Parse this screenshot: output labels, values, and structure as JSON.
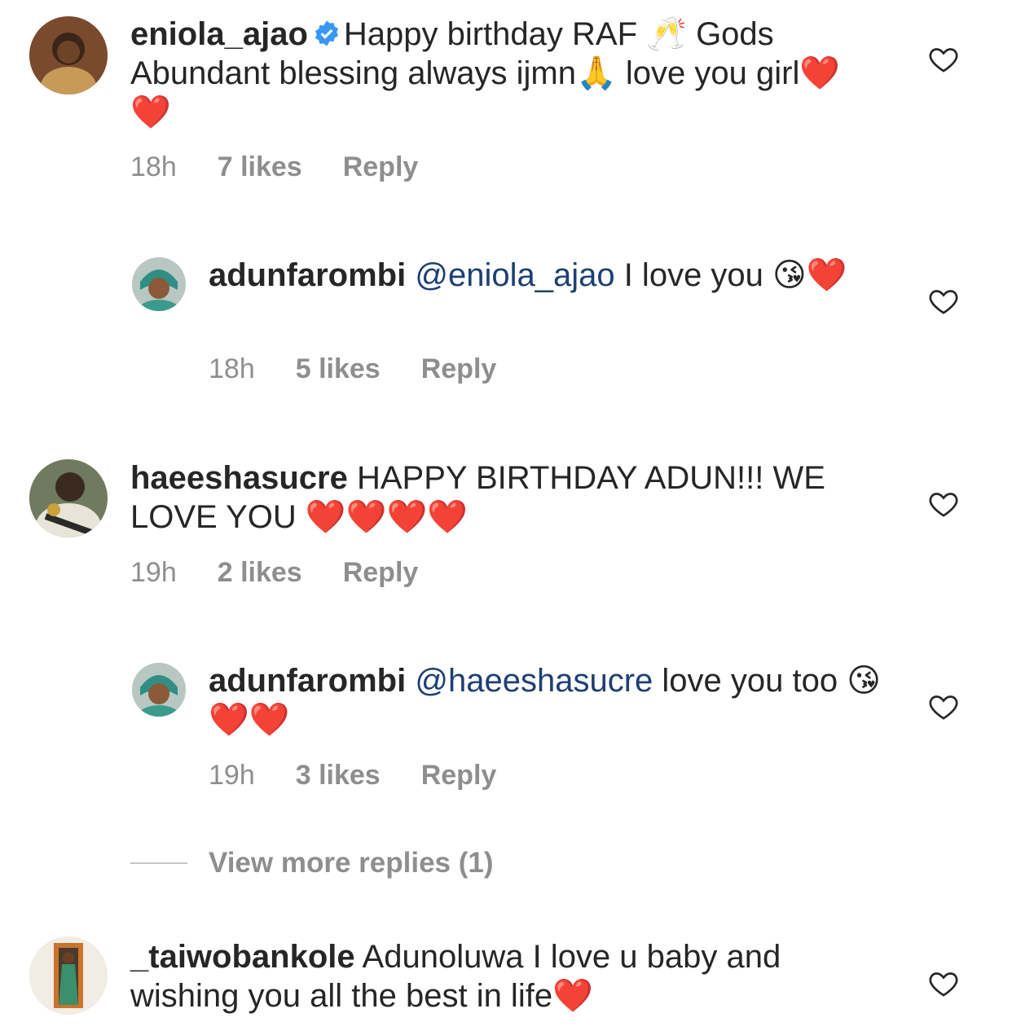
{
  "comments": [
    {
      "username": "eniola_ajao",
      "verified": true,
      "text": "Happy birthday RAF 🥂 Gods Abundant blessing always ijmn🙏 love you girl❤️❤️",
      "time": "18h",
      "likes": "7 likes",
      "reply_label": "Reply"
    },
    {
      "username": "adunfarombi",
      "mention": "@eniola_ajao",
      "text": " I love you 😘❤️",
      "time": "18h",
      "likes": "5 likes",
      "reply_label": "Reply"
    },
    {
      "username": "haeeshasucre",
      "text": "HAPPY BIRTHDAY ADUN!!! WE LOVE YOU ❤️❤️❤️❤️",
      "time": "19h",
      "likes": "2 likes",
      "reply_label": "Reply"
    },
    {
      "username": "adunfarombi",
      "mention": "@haeeshasucre",
      "text": " love you too 😘❤️❤️",
      "time": "19h",
      "likes": "3 likes",
      "reply_label": "Reply"
    },
    {
      "username": "_taiwobankole",
      "text": "Adunoluwa I love u baby and wishing you all the best in life❤️"
    }
  ],
  "view_more_replies": "View more replies (1)",
  "icons": {
    "like": "heart-outline-icon",
    "verified": "verified-badge-icon"
  },
  "colors": {
    "text": "#262626",
    "meta": "#8e8e8e",
    "mention": "#1d3f73",
    "verified": "#3897f0"
  }
}
